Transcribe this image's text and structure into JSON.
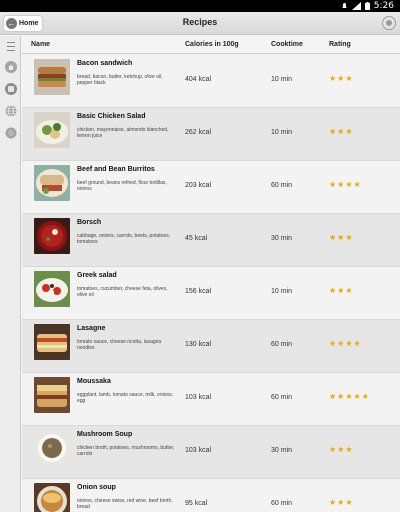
{
  "status_bar": {
    "time": "5:26",
    "icons": [
      "notification-icon",
      "signal-icon",
      "battery-icon"
    ]
  },
  "action_bar": {
    "home_label": "Home",
    "title": "Recipes",
    "home_icon": "back-arrow-icon",
    "settings_icon": "settings-icon"
  },
  "sidebar": {
    "icons": [
      "menu-icon",
      "home-icon",
      "recipes-icon",
      "globe-icon",
      "circle-icon"
    ]
  },
  "table": {
    "headers": {
      "name": "Name",
      "calories": "Calories in 100g",
      "cooktime": "Cooktime",
      "rating": "Rating"
    },
    "rows": [
      {
        "name": "Bacon sandwich",
        "ingredients": "bread, bacon, butter, ketchup, olive oil, pepper black",
        "calories": "404 kcal",
        "cooktime": "10 min",
        "rating": 3
      },
      {
        "name": "Basic Chicken Salad",
        "ingredients": "chicken, mayonnaise, almonds blanched, lemon juice",
        "calories": "262 kcal",
        "cooktime": "10 min",
        "rating": 3
      },
      {
        "name": "Beef and Bean Burritos",
        "ingredients": "beef ground, beans refried, flour tortillas, onions",
        "calories": "203 kcal",
        "cooktime": "60 min",
        "rating": 4
      },
      {
        "name": "Borsch",
        "ingredients": "cabbage, onions, carrots, beets, potatoes, tomatoes",
        "calories": "45 kcal",
        "cooktime": "30 min",
        "rating": 3
      },
      {
        "name": "Greek salad",
        "ingredients": "tomatoes, cucumber, cheese feta, olives, olive oil",
        "calories": "156 kcal",
        "cooktime": "10 min",
        "rating": 3
      },
      {
        "name": "Lasagne",
        "ingredients": "tomato sauce, cheese ricotta, lasagna noodles",
        "calories": "130 kcal",
        "cooktime": "60 min",
        "rating": 4
      },
      {
        "name": "Moussaka",
        "ingredients": "eggplant, lamb, tomato sauce, milk, onions, egg",
        "calories": "103 kcal",
        "cooktime": "60 min",
        "rating": 5
      },
      {
        "name": "Mushroom Soup",
        "ingredients": "chicken broth, potatoes, mushrooms, butter, carrots",
        "calories": "103 kcal",
        "cooktime": "30 min",
        "rating": 3
      },
      {
        "name": "Onion soup",
        "ingredients": "onions, cheese swiss, red wine, beef broth, bread",
        "calories": "95 kcal",
        "cooktime": "60 min",
        "rating": 3
      }
    ]
  },
  "colors": {
    "star": "#e8a800",
    "row_odd": "#f3f3f3",
    "row_even": "#e6e6e6"
  }
}
